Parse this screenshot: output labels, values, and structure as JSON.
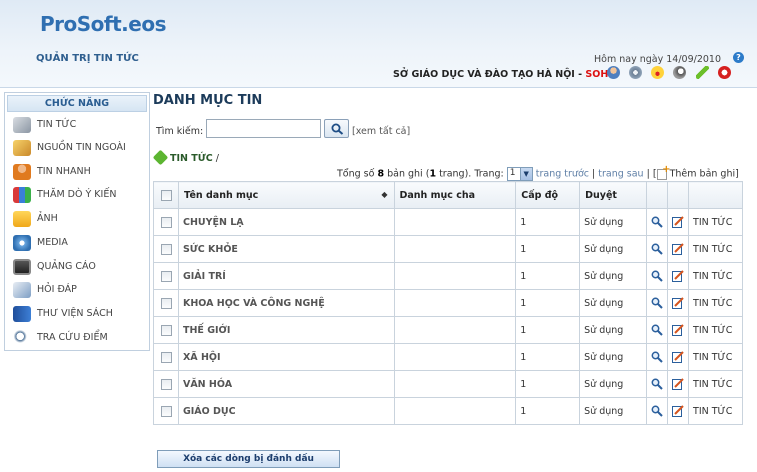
{
  "header": {
    "logo": "ProSoft.eos",
    "section_title": "QUẢN TRỊ TIN TỨC",
    "today": "Hôm nay ngày 14/09/2010",
    "org_name": "SỞ GIÁO DỤC VÀ ĐÀO TẠO HÀ NỘI - ",
    "org_code": "SOHN",
    "help": "?"
  },
  "sidebar": {
    "title": "CHỨC NĂNG",
    "items": [
      {
        "label": "TIN TỨC"
      },
      {
        "label": "NGUỒN TIN NGOÀI"
      },
      {
        "label": "TIN NHANH"
      },
      {
        "label": "THĂM DÒ Ý KIẾN"
      },
      {
        "label": "ẢNH"
      },
      {
        "label": "MEDIA"
      },
      {
        "label": "QUẢNG CÁO"
      },
      {
        "label": "HỎI ĐÁP"
      },
      {
        "label": "THƯ VIỆN SÁCH"
      },
      {
        "label": "TRA CỨU ĐIỂM"
      }
    ]
  },
  "main": {
    "title": "DANH MỤC TIN",
    "search_label": "Tìm kiếm:",
    "search_value": "",
    "see_all": "[xem tất cả]",
    "breadcrumb": "TIN TỨC",
    "breadcrumb_sep": " /",
    "pager": {
      "total_prefix": "Tổng số ",
      "total_count": "8",
      "total_mid": " bản ghi (",
      "pages": "1",
      "total_suffix": " trang). Trang:",
      "current_page": "1",
      "prev": "trang trước",
      "divider": " | ",
      "next": "trang sau",
      "add_record": "Thêm bản ghi"
    },
    "table": {
      "headers": {
        "name": "Tên danh mục",
        "parent": "Danh mục cha",
        "level": "Cấp độ",
        "status": "Duyệt"
      },
      "rows": [
        {
          "name": "CHUYỆN LẠ",
          "parent": "",
          "level": "1",
          "status": "Sử dụng",
          "link": "TIN TỨC"
        },
        {
          "name": "SỨC KHỎE",
          "parent": "",
          "level": "1",
          "status": "Sử dụng",
          "link": "TIN TỨC"
        },
        {
          "name": "GIẢI TRÍ",
          "parent": "",
          "level": "1",
          "status": "Sử dụng",
          "link": "TIN TỨC"
        },
        {
          "name": "KHOA HỌC VÀ CÔNG NGHỆ",
          "parent": "",
          "level": "1",
          "status": "Sử dụng",
          "link": "TIN TỨC"
        },
        {
          "name": "THẾ GIỚI",
          "parent": "",
          "level": "1",
          "status": "Sử dụng",
          "link": "TIN TỨC"
        },
        {
          "name": "XÃ HỘI",
          "parent": "",
          "level": "1",
          "status": "Sử dụng",
          "link": "TIN TỨC"
        },
        {
          "name": "VĂN HÓA",
          "parent": "",
          "level": "1",
          "status": "Sử dụng",
          "link": "TIN TỨC"
        },
        {
          "name": "GIÁO DỤC",
          "parent": "",
          "level": "1",
          "status": "Sử dụng",
          "link": "TIN TỨC"
        }
      ]
    },
    "delete_button": "Xóa các dòng bị đánh dấu"
  },
  "colors": {
    "brand": "#2f6fb1",
    "org_code": "#dd1111",
    "link": "#5f7fa6"
  }
}
